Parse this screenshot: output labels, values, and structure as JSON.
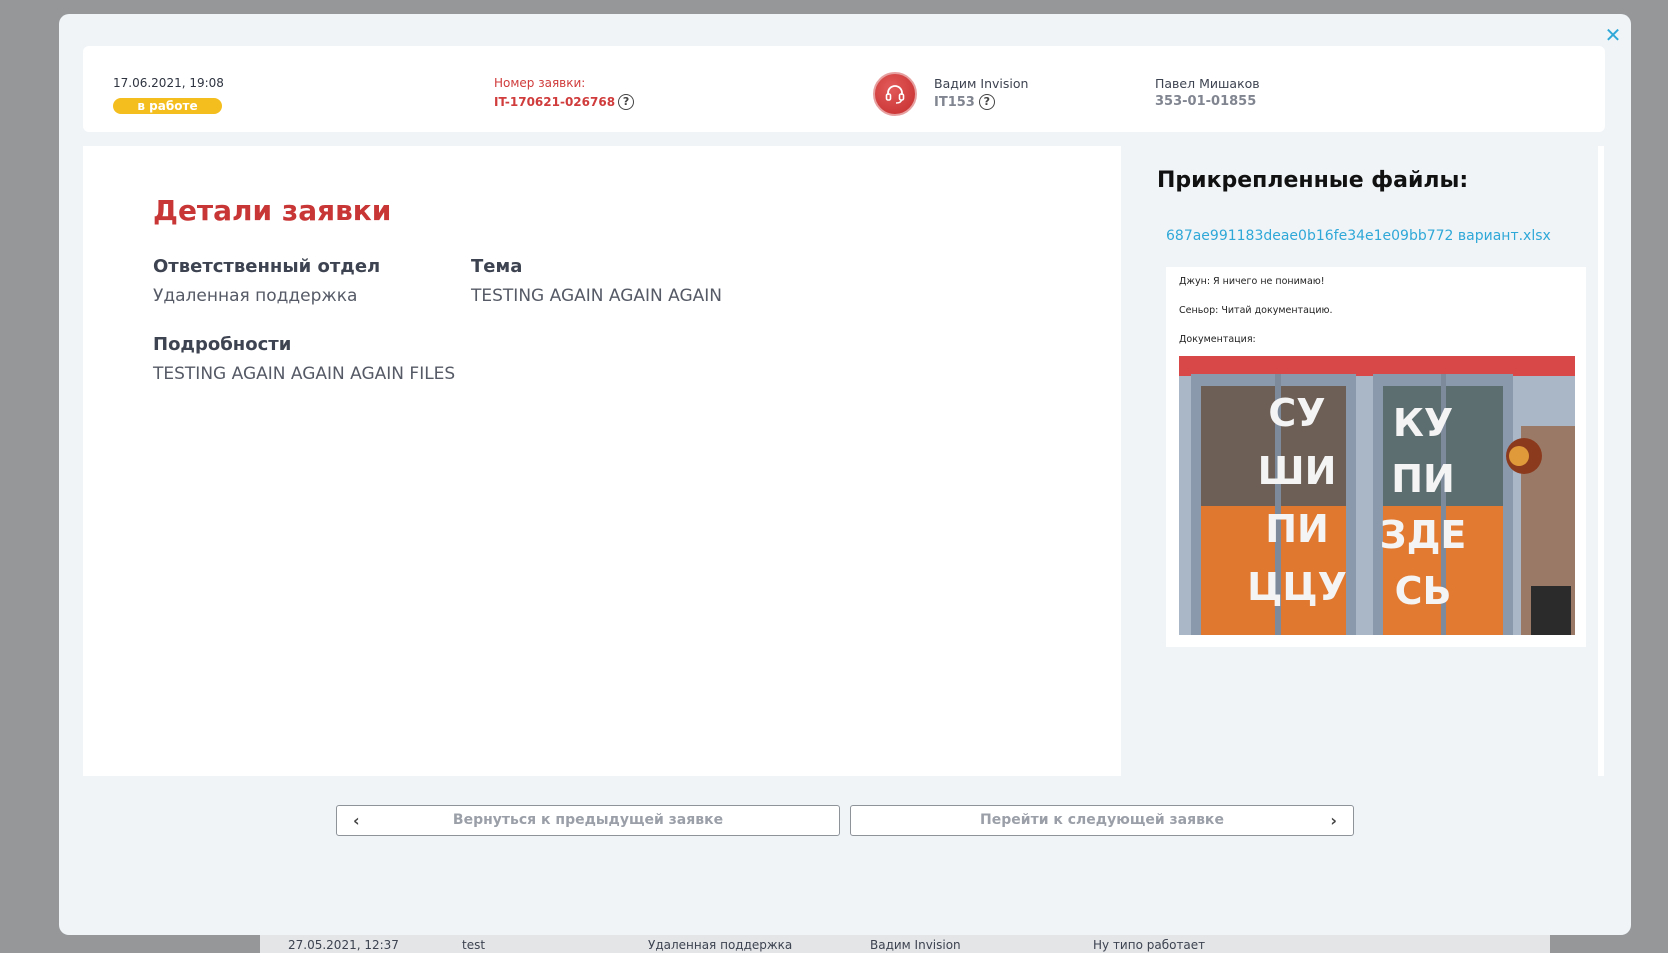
{
  "background_row": {
    "date": "27.05.2021, 12:37",
    "topic": "test",
    "department": "Удаленная поддержка",
    "agent": "Вадим Invision",
    "comment": "Ну типо работает"
  },
  "header": {
    "date": "17.06.2021, 19:08",
    "status": "в работе",
    "number_label": "Номер заявки:",
    "number_value": "IT-170621-026768",
    "agent_name": "Вадим Invision",
    "agent_id": "IT153",
    "client_name": "Павел Мишаков",
    "client_phone": "353-01-01855"
  },
  "details": {
    "title": "Детали заявки",
    "department_label": "Ответственный отдел",
    "department_value": "Удаленная поддержка",
    "topic_label": "Тема",
    "topic_value": "TESTING AGAIN AGAIN AGAIN",
    "details_label": "Подробности",
    "details_value": "TESTING AGAIN AGAIN AGAIN FILES"
  },
  "files": {
    "title": "Прикрепленные файлы:",
    "file_name": "687ae991183deae0b16fe34e1e09bb772 вариант.xlsx",
    "preview_lines": [
      "Джун: Я ничего не понимаю!",
      "Сеньор: Читай документацию.",
      "Документация:"
    ],
    "photo_left_text": [
      "СУ",
      "ШИ",
      "ПИ",
      "ЦЦУ"
    ],
    "photo_right_text": [
      "КУ",
      "ПИ",
      "ЗДЕ",
      "СЬ"
    ]
  },
  "navigation": {
    "prev_label": "Вернуться к предыдущей заявке",
    "next_label": "Перейти к следующей заявке"
  },
  "colors": {
    "accent_red": "#c93636",
    "status_yellow": "#f4be1e",
    "link_blue": "#2fa8d8"
  }
}
